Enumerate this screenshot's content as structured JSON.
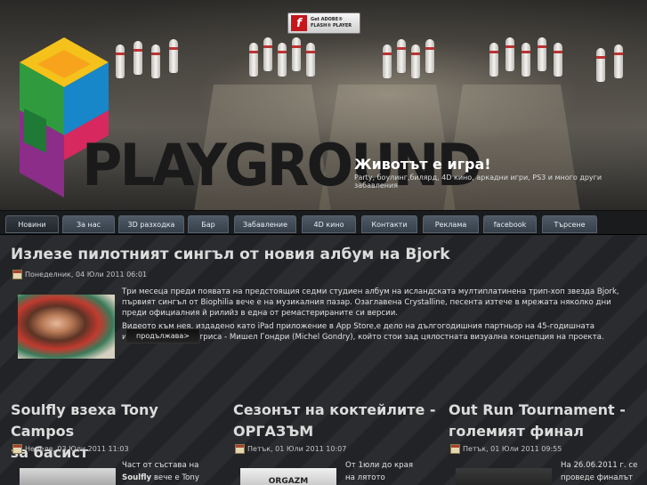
{
  "flash_badge": {
    "line1": "Get ADOBE®",
    "line2": "FLASH® PLAYER"
  },
  "brand": {
    "name": "PLAYGROUND",
    "tagline": "Животът е игра!",
    "subtagline": "Party, боулинг,билярд, 4D кино, аркадни игри, PS3 и много други забавления"
  },
  "nav": [
    {
      "label": "Новини"
    },
    {
      "label": "За нас"
    },
    {
      "label": "3D разходка"
    },
    {
      "label": "Бар"
    },
    {
      "label": "Забавление"
    },
    {
      "label": "4D кино"
    },
    {
      "label": "Контакти"
    },
    {
      "label": "Реклама"
    },
    {
      "label": "facebook"
    },
    {
      "label": "Търсене"
    }
  ],
  "featured": {
    "title": "Излезе пилотният сингъл от новия албум на Bjork",
    "date": "Понеделник, 04 Юли 2011 06:01",
    "paragraph1": "Три месеца преди появата на предстоящия седми студиен албум на исландската мултиплатинена трип-хоп звезда Bjork, първият сингъл от Biophilia вече е на музикалния пазар. Озаглавена Crystalline, песента изтече в мрежата няколко дни преди официалния й рилийз в една от ремастерираните си версии.",
    "paragraph2": "Видеото към нея, издадено като iPad приложение в App Store,е дело на дългогодишния партньор на 45-годишната изпълнителка и актриса - Мишел Гондри (Michel Gondry), който стои зад цялостната визуална концепция на проекта.",
    "more_label": "продължава>"
  },
  "columns": [
    {
      "title_l1": "Soulfly взеха Tony Campos",
      "title_l2": "за басист",
      "date": "Неделя, 03 Юли 2011 11:03",
      "text_l1": "Част от състава на",
      "text_l2_bold": "Soulfly",
      "text_l2": " вече е   Tony"
    },
    {
      "title_l1": "Сезонът на коктейлите -",
      "title_l2": "ОРГАЗЪМ",
      "date": "Петък, 01 Юли 2011 10:07",
      "text_l1": "От 1юли до края",
      "text_l2": "на лятото",
      "thumb_label": "ORGAZM"
    },
    {
      "title_l1": "Out Run Tournament -",
      "title_l2": "големият финал",
      "date": "Петък, 01 Юли 2011 09:55",
      "text_l1": "На 26.06.2011 г. се",
      "text_l2": "проведе финалът"
    }
  ]
}
